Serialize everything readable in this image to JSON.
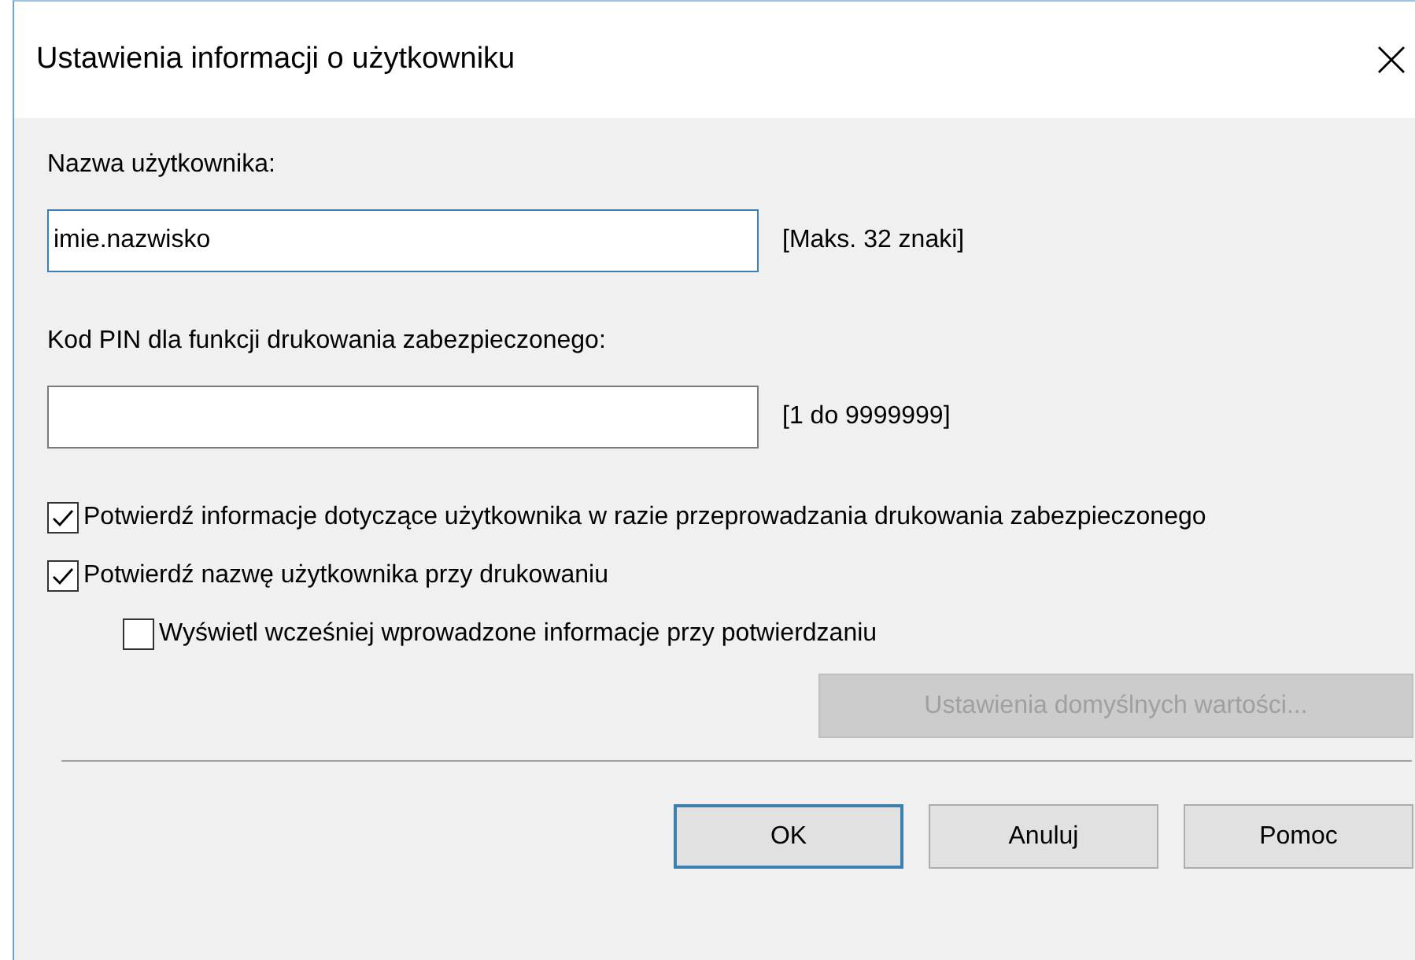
{
  "window": {
    "title": "Ustawienia informacji o użytkowniku"
  },
  "fields": [
    {
      "label": "Nazwa użytkownika:",
      "value": "imie.nazwisko",
      "hint": "[Maks. 32 znaki]",
      "focused": true
    },
    {
      "label": "Kod PIN dla funkcji drukowania zabezpieczonego:",
      "hint": "[1 do 9999999]",
      "focused": false
    }
  ],
  "checkboxes": [
    {
      "label": "Potwierdź informacje dotyczące użytkownika w razie przeprowadzania drukowania zabezpieczonego",
      "checked": true
    },
    {
      "label": "Potwierdź nazwę użytkownika przy drukowaniu",
      "checked": true,
      "children": [
        {
          "label": "Wyświetl wcześniej wprowadzone informacje przy potwierdzaniu",
          "checked": false
        }
      ]
    }
  ],
  "defaults_button": {
    "label": "Ustawienia domyślnych wartości...",
    "disabled": true
  },
  "buttons": [
    {
      "label": "OK",
      "default": true
    },
    {
      "label": "Anuluj",
      "default": false
    },
    {
      "label": "Pomoc",
      "default": false
    }
  ]
}
